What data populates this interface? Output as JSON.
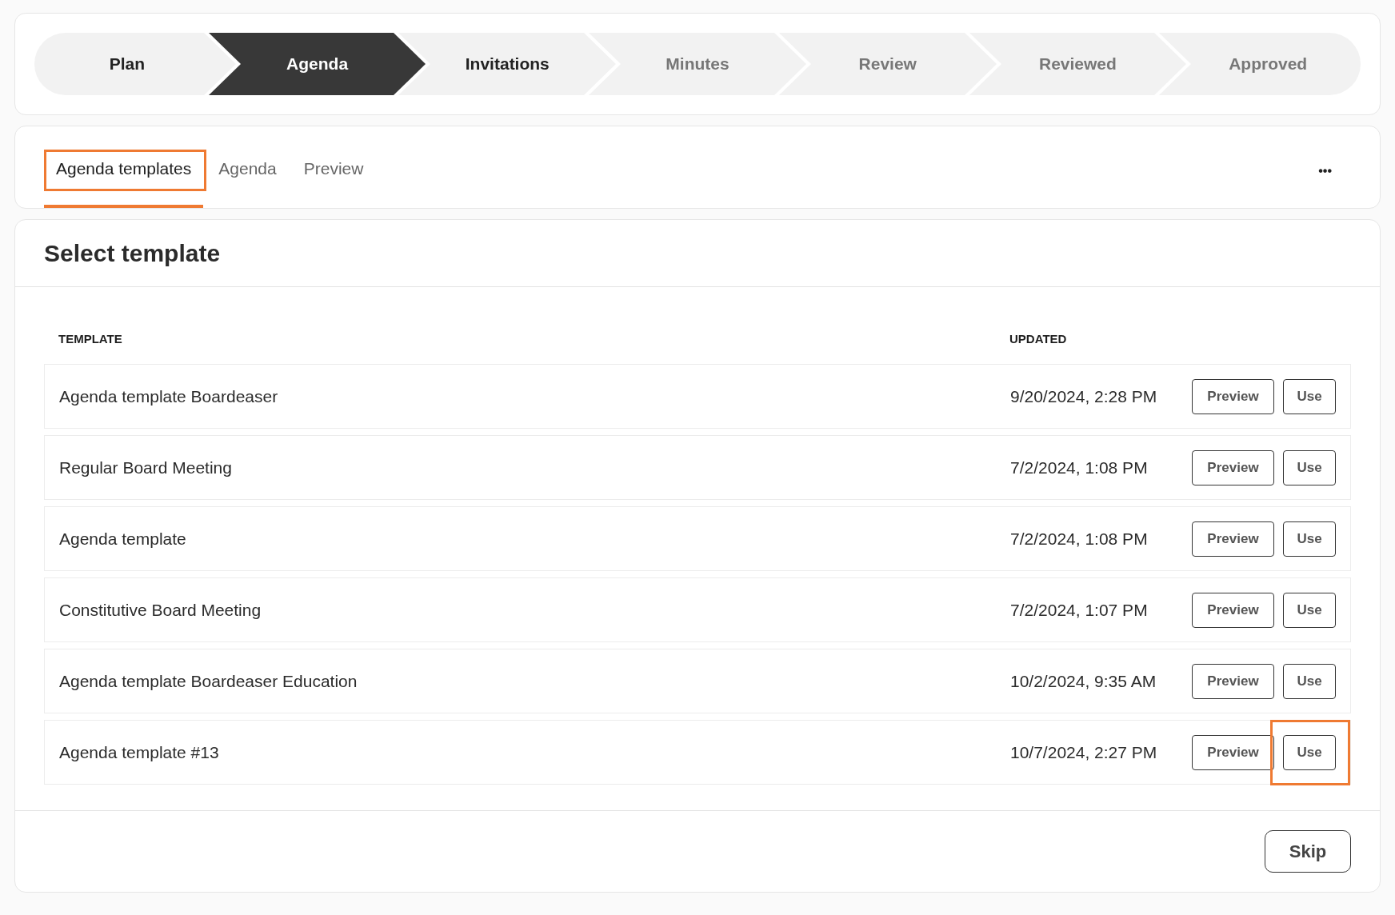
{
  "stepper": [
    {
      "label": "Plan",
      "current": false,
      "disabled": false
    },
    {
      "label": "Agenda",
      "current": true,
      "disabled": false
    },
    {
      "label": "Invitations",
      "current": false,
      "disabled": false
    },
    {
      "label": "Minutes",
      "current": false,
      "disabled": true
    },
    {
      "label": "Review",
      "current": false,
      "disabled": true
    },
    {
      "label": "Reviewed",
      "current": false,
      "disabled": true
    },
    {
      "label": "Approved",
      "current": false,
      "disabled": true
    }
  ],
  "tabs": [
    {
      "label": "Agenda templates",
      "selected": true,
      "highlighted": true
    },
    {
      "label": "Agenda",
      "selected": false,
      "highlighted": false
    },
    {
      "label": "Preview",
      "selected": false,
      "highlighted": false
    }
  ],
  "more_button": "•••",
  "panel": {
    "title": "Select template",
    "table": {
      "columns": [
        "TEMPLATE",
        "UPDATED"
      ],
      "rows": [
        {
          "template": "Agenda template Boardeaser",
          "updated": "9/20/2024, 2:28 PM",
          "preview_button": "Preview",
          "use_button": "Use",
          "use_highlighted": false
        },
        {
          "template": "Regular Board Meeting",
          "updated": "7/2/2024, 1:08 PM",
          "preview_button": "Preview",
          "use_button": "Use",
          "use_highlighted": false
        },
        {
          "template": "Agenda template",
          "updated": "7/2/2024, 1:08 PM",
          "preview_button": "Preview",
          "use_button": "Use",
          "use_highlighted": false
        },
        {
          "template": "Constitutive Board Meeting",
          "updated": "7/2/2024, 1:07 PM",
          "preview_button": "Preview",
          "use_button": "Use",
          "use_highlighted": false
        },
        {
          "template": "Agenda template Boardeaser Education",
          "updated": "10/2/2024, 9:35 AM",
          "preview_button": "Preview",
          "use_button": "Use",
          "use_highlighted": false
        },
        {
          "template": "Agenda template #13",
          "updated": "10/7/2024, 2:27 PM",
          "preview_button": "Preview",
          "use_button": "Use",
          "use_highlighted": true
        }
      ]
    },
    "skip_button": "Skip"
  }
}
